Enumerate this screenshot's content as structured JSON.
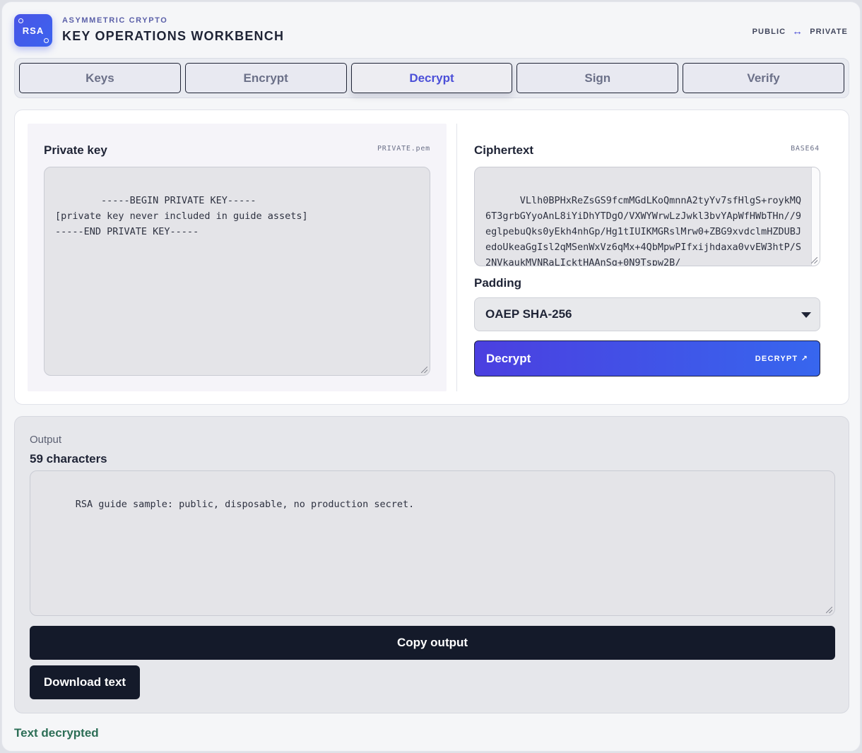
{
  "header": {
    "logo_text": "RSA",
    "eyebrow": "ASYMMETRIC CRYPTO",
    "title": "KEY OPERATIONS WORKBENCH",
    "direction_left": "PUBLIC",
    "direction_arrow": "↔",
    "direction_right": "PRIVATE"
  },
  "tabs": [
    {
      "label": "Keys"
    },
    {
      "label": "Encrypt"
    },
    {
      "label": "Decrypt",
      "active": true
    },
    {
      "label": "Sign"
    },
    {
      "label": "Verify"
    }
  ],
  "private_key": {
    "label": "Private key",
    "tag": "PRIVATE.pem",
    "value": "-----BEGIN PRIVATE KEY-----\n[private key never included in guide assets]\n-----END PRIVATE KEY-----"
  },
  "ciphertext": {
    "label": "Ciphertext",
    "tag": "BASE64",
    "value": "VLlh0BPHxReZsGS9fcmMGdLKoQmnnA2tyYv7sfHlgS+roykMQ6T3grbGYyoAnL8iYiDhYTDgO/VXWYWrwLzJwkl3bvYApWfHWbTHn//9eglpebuQks0yEkh4nhGp/Hg1tIUIKMGRslMrw0+ZBG9xvdclmHZDUBJedoUkeaGgIsl2qMSenWxVz6qMx+4QbMpwPIfxijhdaxa0vvEW3htP/S2NVkaukMVNRaLIcktHAAnSg+0N9Tspw2B/"
  },
  "padding": {
    "label": "Padding",
    "selected": "OAEP SHA-256"
  },
  "decrypt_button": {
    "label": "Decrypt",
    "side_label": "DECRYPT ↗"
  },
  "output": {
    "label": "Output",
    "count": "59 characters",
    "value": "RSA guide sample: public, disposable, no production secret.",
    "copy_label": "Copy output",
    "download_label": "Download text"
  },
  "status": "Text decrypted",
  "colors": {
    "accent": "#4b4fd8",
    "dark_button": "#141a2a",
    "success": "#2c6e56"
  }
}
